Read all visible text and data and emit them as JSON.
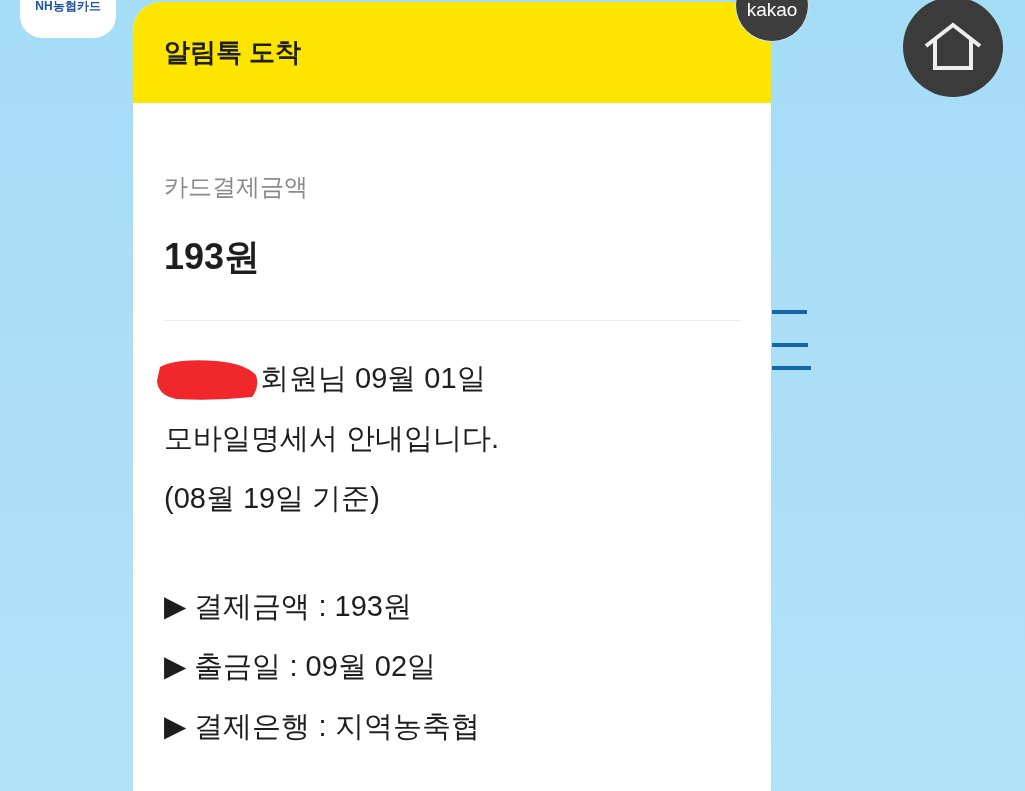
{
  "brand_logo": {
    "text": "NH농협카드"
  },
  "badge": {
    "text": "kakao"
  },
  "header": {
    "title": "알림톡 도착"
  },
  "amount": {
    "label": "카드결제금액",
    "value": "193원"
  },
  "message": {
    "greeting": "회원님 09월 01일",
    "redacted": true,
    "lines": [
      "모바일명세서 안내입니다.",
      "(08월 19일 기준)"
    ],
    "details": [
      "▶ 결제금액 : 193원",
      "▶ 출금일 : 09월 02일",
      "▶ 결제은행 : 지역농축협"
    ]
  }
}
